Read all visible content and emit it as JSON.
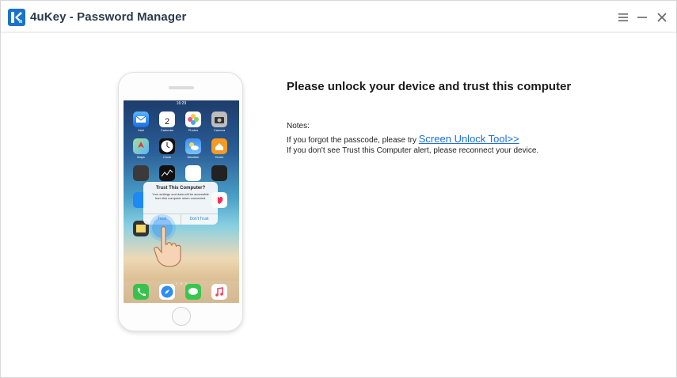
{
  "window": {
    "title": "4uKey - Password Manager"
  },
  "phone": {
    "status_time": "16:29",
    "apps": {
      "mail": "Mail",
      "calendar": "Calendar",
      "calendar_day": "2",
      "photos": "Photos",
      "camera": "Camera",
      "maps": "Maps",
      "clock": "Clock",
      "weather": "Weather",
      "home": "Home"
    },
    "dialog": {
      "title": "Trust This Computer?",
      "message": "Your settings and data will be accessible from this computer when connected.",
      "trust": "Trust",
      "dont_trust": "Don't Trust"
    }
  },
  "main": {
    "heading": "Please unlock your device and trust this computer",
    "notes_label": "Notes:",
    "note1_prefix": "If you forgot the passcode, please try ",
    "note1_link": "Screen Unlock Tool>>",
    "note2": "If you don't see Trust this Computer alert, please reconnect your device."
  },
  "colors": {
    "accent": "#1a73c8",
    "link": "#1d6fd6"
  }
}
